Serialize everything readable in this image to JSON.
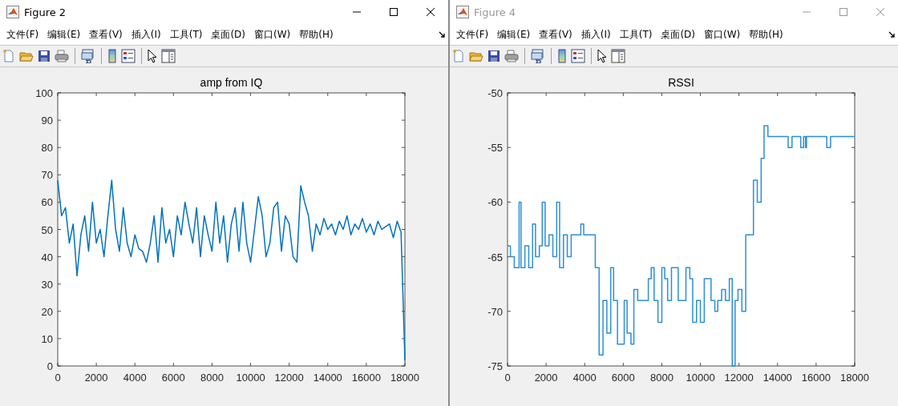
{
  "windows": [
    {
      "title": "Figure 2",
      "active": true,
      "menu": [
        "文件(F)",
        "编辑(E)",
        "查看(V)",
        "插入(I)",
        "工具(T)",
        "桌面(D)",
        "窗口(W)",
        "帮助(H)"
      ],
      "chart_data": {
        "type": "line",
        "title": "amp from IQ",
        "xlim": [
          0,
          18000
        ],
        "ylim": [
          0,
          100
        ],
        "xticks": [
          0,
          2000,
          4000,
          6000,
          8000,
          10000,
          12000,
          14000,
          16000,
          18000
        ],
        "yticks": [
          0,
          10,
          20,
          30,
          40,
          50,
          60,
          70,
          80,
          90,
          100
        ],
        "x": [
          0,
          200,
          400,
          600,
          800,
          1000,
          1200,
          1400,
          1600,
          1800,
          2000,
          2200,
          2400,
          2600,
          2800,
          3000,
          3200,
          3400,
          3600,
          3800,
          4000,
          4200,
          4400,
          4600,
          4800,
          5000,
          5200,
          5400,
          5600,
          5800,
          6000,
          6200,
          6400,
          6600,
          6800,
          7000,
          7200,
          7400,
          7600,
          7800,
          8000,
          8200,
          8400,
          8600,
          8800,
          9000,
          9200,
          9400,
          9600,
          9800,
          10000,
          10200,
          10400,
          10600,
          10800,
          11000,
          11200,
          11400,
          11600,
          11800,
          12000,
          12200,
          12400,
          12600,
          12800,
          13000,
          13200,
          13400,
          13600,
          13800,
          14000,
          14200,
          14400,
          14600,
          14800,
          15000,
          15200,
          15400,
          15600,
          15800,
          16000,
          16200,
          16400,
          16600,
          16800,
          17000,
          17200,
          17400,
          17600,
          17800,
          18000
        ],
        "series": [
          {
            "color": "#0072bd",
            "values": [
              68,
              55,
              58,
              45,
              52,
              33,
              48,
              55,
              42,
              60,
              45,
              50,
              40,
              55,
              68,
              50,
              42,
              58,
              45,
              40,
              48,
              43,
              42,
              38,
              45,
              55,
              38,
              58,
              45,
              50,
              40,
              55,
              48,
              60,
              52,
              45,
              58,
              40,
              55,
              48,
              42,
              60,
              45,
              55,
              38,
              52,
              58,
              42,
              60,
              45,
              38,
              50,
              62,
              55,
              40,
              45,
              58,
              60,
              42,
              55,
              52,
              40,
              38,
              66,
              60,
              55,
              42,
              52,
              48,
              54,
              50,
              52,
              48,
              53,
              50,
              55,
              48,
              52,
              50,
              54,
              49,
              52,
              48,
              53,
              50,
              51,
              52,
              47,
              53,
              49,
              2
            ]
          }
        ]
      }
    },
    {
      "title": "Figure 4",
      "active": false,
      "menu": [
        "文件(F)",
        "编辑(E)",
        "查看(V)",
        "插入(I)",
        "工具(T)",
        "桌面(D)",
        "窗口(W)",
        "帮助(H)"
      ],
      "chart_data": {
        "type": "line",
        "title": "RSSI",
        "xlim": [
          0,
          18000
        ],
        "ylim": [
          -75,
          -50
        ],
        "xticks": [
          0,
          2000,
          4000,
          6000,
          8000,
          10000,
          12000,
          14000,
          16000,
          18000
        ],
        "yticks": [
          -75,
          -70,
          -65,
          -60,
          -55,
          -50
        ],
        "x": [
          0,
          150,
          150,
          350,
          350,
          600,
          600,
          700,
          700,
          900,
          900,
          1100,
          1100,
          1300,
          1300,
          1450,
          1450,
          1650,
          1650,
          1800,
          1800,
          1950,
          1950,
          2150,
          2150,
          2350,
          2350,
          2550,
          2550,
          2700,
          2700,
          2900,
          2900,
          3100,
          3100,
          3300,
          3300,
          3800,
          3800,
          3950,
          3950,
          4550,
          4550,
          4750,
          4750,
          4950,
          4950,
          5150,
          5150,
          5350,
          5350,
          5500,
          5500,
          5700,
          5700,
          6050,
          6050,
          6200,
          6200,
          6400,
          6400,
          6550,
          6550,
          6750,
          6750,
          7300,
          7300,
          7450,
          7450,
          7600,
          7600,
          7800,
          7800,
          8000,
          8000,
          8150,
          8150,
          8300,
          8300,
          8500,
          8500,
          8850,
          8850,
          9250,
          9250,
          9450,
          9450,
          9600,
          9600,
          9800,
          9800,
          10000,
          10000,
          10200,
          10200,
          10550,
          10550,
          10750,
          10750,
          10900,
          10900,
          11100,
          11100,
          11300,
          11300,
          11500,
          11500,
          11650,
          11650,
          11800,
          11800,
          11950,
          11950,
          12150,
          12150,
          12350,
          12350,
          12750,
          12750,
          12950,
          12950,
          13150,
          13150,
          13300,
          13300,
          13500,
          13500,
          14550,
          14550,
          14750,
          14750,
          15200,
          15200,
          15350,
          15350,
          15450,
          15450,
          15500,
          15500,
          16550,
          16550,
          16750,
          16750,
          18000
        ],
        "series": [
          {
            "color": "#2b8fd6",
            "values": [
              -64,
              -64,
              -65,
              -65,
              -66,
              -66,
              -60,
              -60,
              -66,
              -66,
              -64,
              -64,
              -66,
              -66,
              -62,
              -62,
              -65,
              -65,
              -64,
              -64,
              -60,
              -60,
              -64,
              -64,
              -63,
              -63,
              -65,
              -65,
              -60,
              -60,
              -66,
              -66,
              -63,
              -63,
              -65,
              -65,
              -63,
              -63,
              -62,
              -62,
              -63,
              -63,
              -66,
              -66,
              -74,
              -74,
              -69,
              -69,
              -72,
              -72,
              -66,
              -66,
              -69,
              -69,
              -73,
              -73,
              -69,
              -69,
              -72,
              -72,
              -73,
              -73,
              -68,
              -68,
              -69,
              -69,
              -67,
              -67,
              -66,
              -66,
              -69,
              -69,
              -71,
              -71,
              -66,
              -66,
              -67,
              -67,
              -69,
              -69,
              -66,
              -66,
              -69,
              -69,
              -66,
              -66,
              -67,
              -67,
              -71,
              -71,
              -69,
              -69,
              -71,
              -71,
              -67,
              -67,
              -69,
              -69,
              -70,
              -70,
              -69,
              -69,
              -68,
              -68,
              -69,
              -69,
              -67,
              -67,
              -75,
              -75,
              -69,
              -69,
              -68,
              -68,
              -70,
              -70,
              -63,
              -63,
              -58,
              -58,
              -60,
              -60,
              -56,
              -56,
              -53,
              -53,
              -54,
              -54,
              -55,
              -55,
              -54,
              -54,
              -55,
              -55,
              -54,
              -54,
              -55,
              -55,
              -54,
              -54,
              -55,
              -55,
              -54,
              -54
            ]
          }
        ]
      }
    }
  ]
}
